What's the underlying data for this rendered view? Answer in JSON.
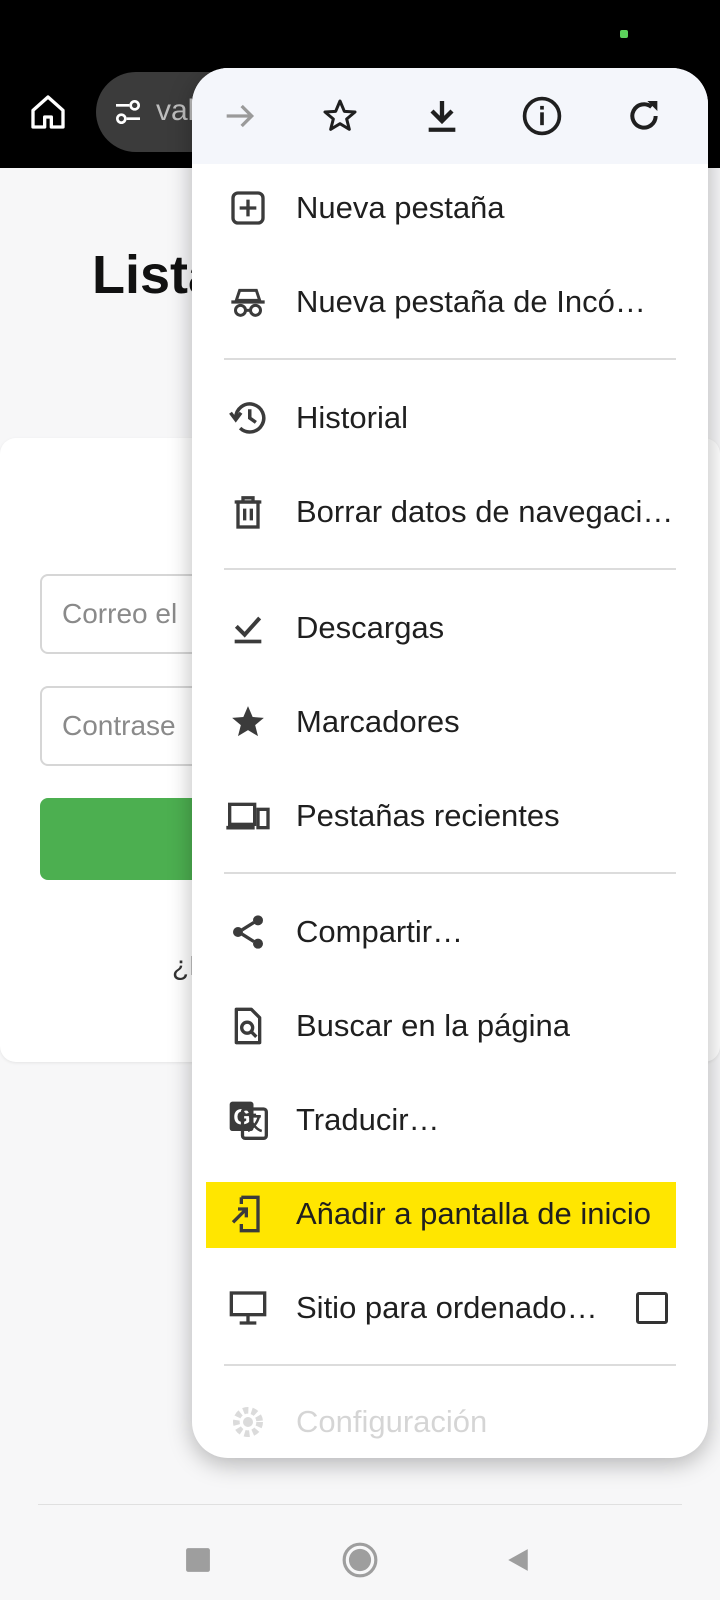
{
  "toolbar": {
    "url_partial": "vak"
  },
  "page": {
    "title_partial": "Lista",
    "email_placeholder_partial": "Correo el",
    "password_placeholder_partial": "Contrase",
    "hint_partial": "¿I"
  },
  "menu": {
    "top_actions": [
      {
        "name": "forward",
        "icon": "arrow-right-icon"
      },
      {
        "name": "bookmark",
        "icon": "star-outline-icon"
      },
      {
        "name": "download",
        "icon": "download-icon"
      },
      {
        "name": "info",
        "icon": "info-icon"
      },
      {
        "name": "reload",
        "icon": "reload-icon"
      }
    ],
    "items": [
      {
        "label": "Nueva pestaña",
        "icon": "new-tab-icon"
      },
      {
        "label": "Nueva pestaña de Incó…",
        "icon": "incognito-icon"
      },
      {
        "label": "Historial",
        "icon": "history-icon"
      },
      {
        "label": "Borrar datos de navegaci…",
        "icon": "trash-icon"
      },
      {
        "label": "Descargas",
        "icon": "downloads-check-icon"
      },
      {
        "label": "Marcadores",
        "icon": "star-filled-icon"
      },
      {
        "label": "Pestañas recientes",
        "icon": "devices-icon"
      },
      {
        "label": "Compartir…",
        "icon": "share-icon"
      },
      {
        "label": "Buscar en la página",
        "icon": "find-in-page-icon"
      },
      {
        "label": "Traducir…",
        "icon": "translate-icon"
      },
      {
        "label": "Añadir a pantalla de inicio",
        "icon": "add-to-home-icon",
        "highlighted": true
      },
      {
        "label": "Sitio para ordenado…",
        "icon": "desktop-icon",
        "checkbox": false
      },
      {
        "label": "Configuración",
        "icon": "gear-icon"
      }
    ]
  },
  "colors": {
    "highlight": "#ffe600",
    "login_button": "#4caf50",
    "toolbar_bg": "#000000",
    "menu_top_bg": "#f4f6fb"
  }
}
